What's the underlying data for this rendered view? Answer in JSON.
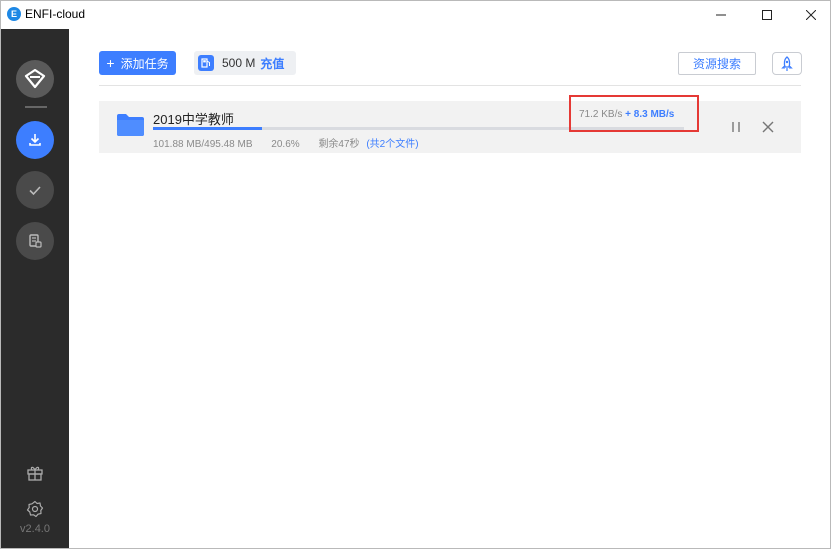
{
  "window": {
    "title": "ENFI-cloud",
    "logo_letter": "E"
  },
  "sidebar": {
    "version": "v2.4.0",
    "items": [
      {
        "name": "download",
        "icon": "download-icon",
        "active": true
      },
      {
        "name": "completed",
        "icon": "check-icon",
        "active": false
      },
      {
        "name": "cloud-files",
        "icon": "document-icon",
        "active": false
      }
    ],
    "bottom_icons": [
      "gift-icon",
      "settings-icon"
    ]
  },
  "toolbar": {
    "add_task_label": "添加任务",
    "quota_size": "500 M",
    "recharge_label": "充值",
    "resource_search_label": "资源搜索"
  },
  "tasks": [
    {
      "name": "2019中学教师",
      "downloaded": "101.88 MB/495.48 MB",
      "percent_label": "20.6%",
      "progress": 0.206,
      "remaining": "剩余47秒",
      "files_label": "(共2个文件)",
      "speed": "71.2 KB/s",
      "boost_speed": "+ 8.3 MB/s"
    }
  ],
  "colors": {
    "accent": "#3d7eff",
    "sidebar_bg": "#2b2b2b",
    "highlight_border": "#e53935"
  }
}
